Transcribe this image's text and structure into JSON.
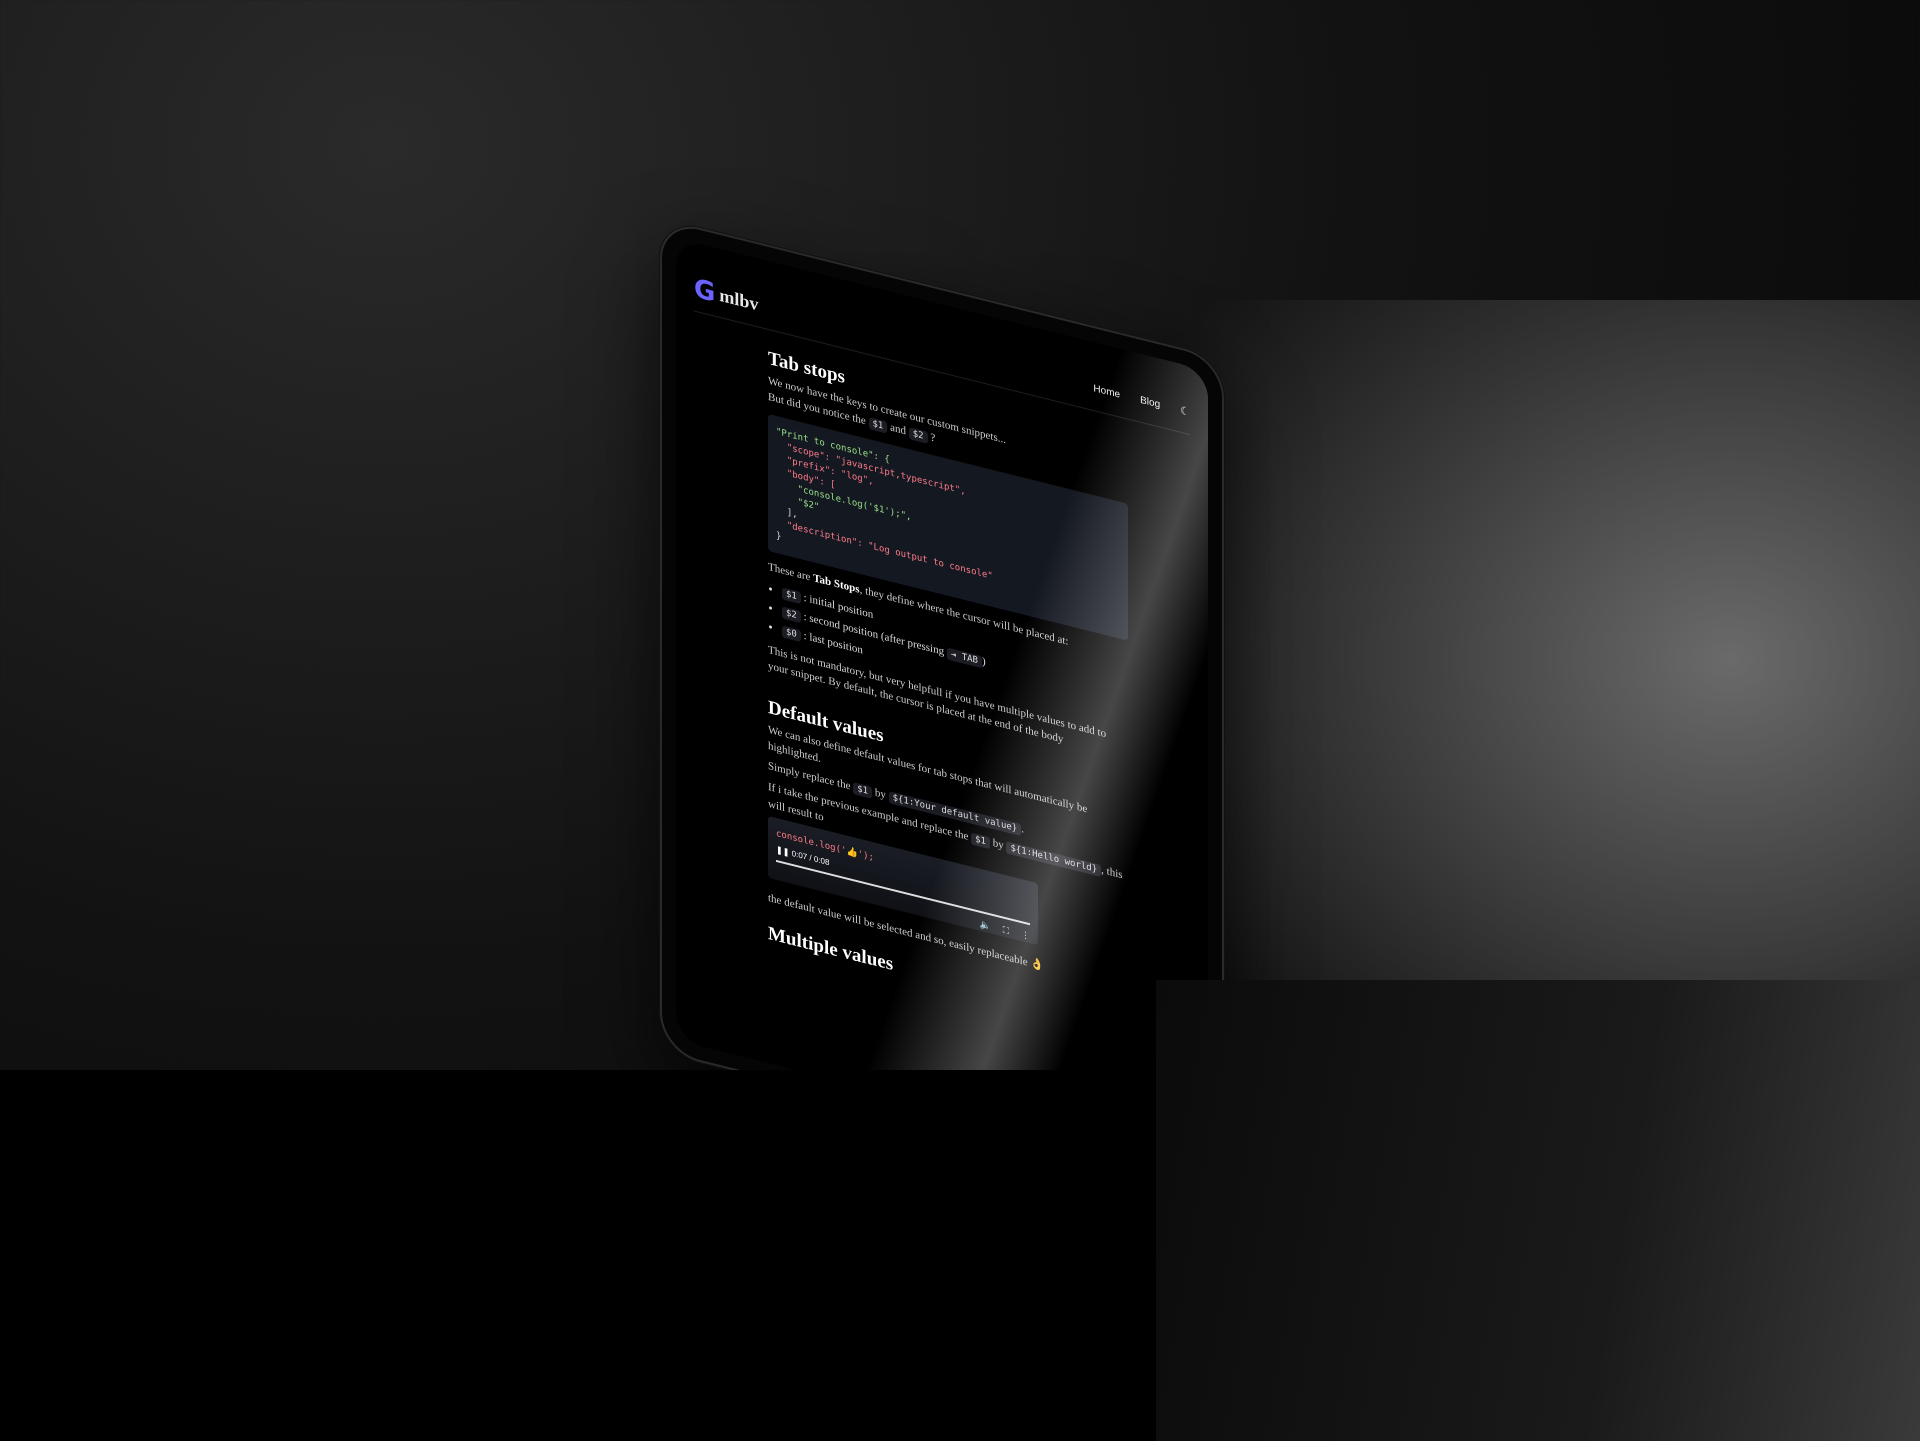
{
  "header": {
    "logo_mark": "G",
    "logo_text": "mlbv",
    "nav": [
      "Home",
      "Blog"
    ],
    "theme_icon": "moon-icon"
  },
  "article": {
    "h_tab_stops": "Tab stops",
    "p1a": "We now have the keys to create our custom snippets...",
    "p1b": "But did you notice the",
    "c1": "$1",
    "and": "and",
    "c2": "$2",
    "q": "?",
    "code": [
      "\"Print to console\": {",
      "  \"scope\": \"javascript,typescript\",",
      "  \"prefix\": \"log\",",
      "  \"body\": [",
      "    \"console.log('$1');\",",
      "    \"$2\"",
      "  ],",
      "  \"description\": \"Log output to console\"",
      "}"
    ],
    "p2a": "These are",
    "p2b": "Tab Stops",
    "p2c": ", they define where the cursor will be placed at:",
    "list": [
      {
        "code": "$1",
        "text": ": initial position"
      },
      {
        "code": "$2",
        "text": ": second position (after pressing"
      },
      {
        "code": "$0",
        "text": ": last position"
      }
    ],
    "tab_key": "⇥ TAB",
    "close_paren": ")",
    "p3": "This is not mandatory, but very helpfull if you have multiple values to add to your snippet. By default, the cursor is placed at the end of the body",
    "h_default": "Default values",
    "p4": "We can also define default values for tab stops that will automatically be highlighted.",
    "p5a": "Simply replace the",
    "p5c": "$1",
    "p5b": "by",
    "p5d": "${1:Your default value}",
    "p5e": ".",
    "p6a": "If i take the previous example and replace the",
    "p6c": "$1",
    "p6b": "by",
    "p6d": "${1:Hello world}",
    "p6e": ", this will result to",
    "video_line": "console.log('👍');",
    "video_time": "0:07 / 0:08",
    "p7": "the default value will be selected and so, easily replaceable 👌",
    "h_multiple": "Multiple values"
  }
}
